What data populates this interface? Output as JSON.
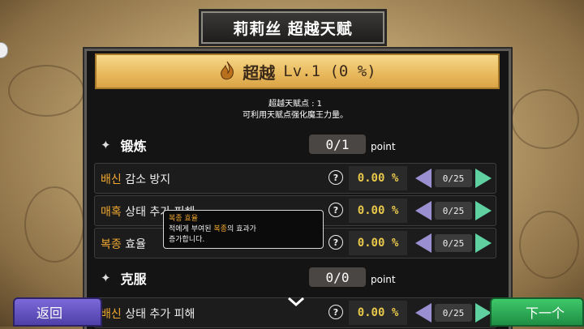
{
  "header": {
    "title": "莉莉丝  超越天赋"
  },
  "banner": {
    "title": "超越",
    "level": "Lv.1 (0 %)"
  },
  "info": {
    "line1": "超越天赋点 : 1",
    "line2": "可利用天赋点强化魔王力量。"
  },
  "sections": [
    {
      "title": "锻炼",
      "points": "0/1",
      "points_label": "point"
    },
    {
      "title": "克服",
      "points": "0/0",
      "points_label": "point"
    }
  ],
  "rows": [
    {
      "highlight": "배신",
      "rest": " 감소 방지",
      "value": "0.00 %",
      "count": "0/25"
    },
    {
      "highlight": "매혹",
      "rest": " 상태 추가 피해",
      "value": "0.00 %",
      "count": "0/25"
    },
    {
      "highlight": "복종",
      "rest": " 효율",
      "value": "0.00 %",
      "count": "0/25"
    },
    {
      "highlight": "배신",
      "rest": " 상태 추가 피해",
      "value": "0.00 %",
      "count": "0/25"
    }
  ],
  "tooltip": {
    "title": "복종 효율",
    "pre": "적에게 부여된 ",
    "hl": "복종",
    "post": "의 효과가",
    "line3": "증가합니다."
  },
  "buttons": {
    "back": "返回",
    "next": "下一个"
  },
  "colors": {
    "accent": "#f0a830",
    "value": "#e8c84b",
    "back": "#5f4fc0",
    "next": "#2aa552"
  }
}
